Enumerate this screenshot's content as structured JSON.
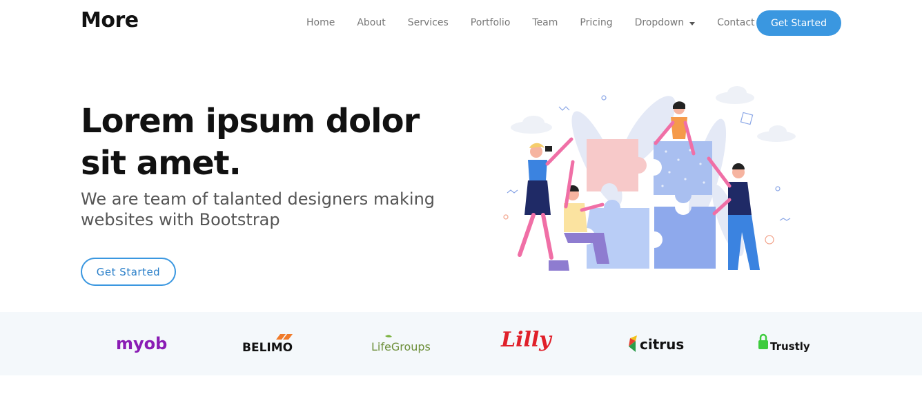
{
  "header": {
    "logo": "More",
    "nav": [
      {
        "label": "Home"
      },
      {
        "label": "About"
      },
      {
        "label": "Services"
      },
      {
        "label": "Portfolio"
      },
      {
        "label": "Team"
      },
      {
        "label": "Pricing"
      },
      {
        "label": "Dropdown"
      },
      {
        "label": "Contact"
      }
    ],
    "cta_label": "Get Started"
  },
  "hero": {
    "title": "Lorem ipsum dolor sit amet.",
    "subtitle": "We are team of talanted designers making websites with Bootstrap",
    "button_label": "Get Started"
  },
  "clients": [
    {
      "name": "myob",
      "icon": "myob-logo"
    },
    {
      "name": "BELIMO",
      "icon": "belimo-logo"
    },
    {
      "name": "LifeGroups",
      "icon": "lifegroups-logo"
    },
    {
      "name": "Lilly",
      "icon": "lilly-logo"
    },
    {
      "name": "citrus",
      "icon": "citrus-logo"
    },
    {
      "name": "Trustly",
      "icon": "trustly-logo"
    }
  ],
  "colors": {
    "accent": "#3a97e0",
    "clients_bg": "#f4f8fb"
  }
}
